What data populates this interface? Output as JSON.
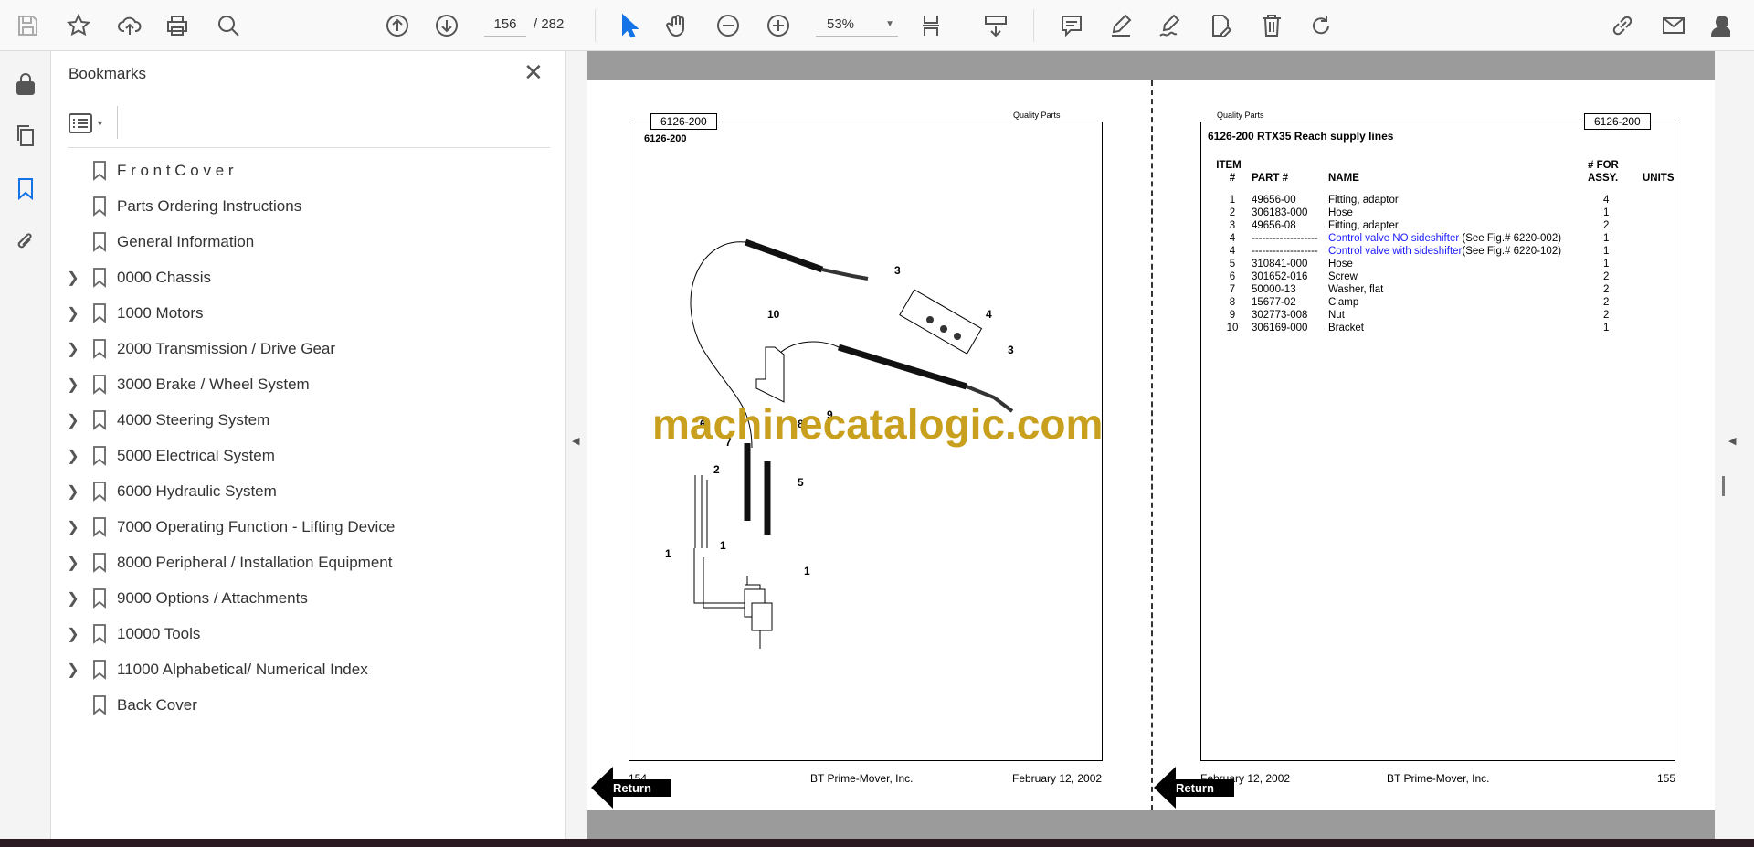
{
  "toolbar": {
    "current_page": "156",
    "total_pages": "/ 282",
    "zoom": "53%",
    "icons": [
      "save-icon",
      "star-icon",
      "upload-icon",
      "print-icon",
      "find-icon",
      "page-up-icon",
      "page-down-icon",
      "select-cursor-icon",
      "hand-icon",
      "zoom-out-icon",
      "zoom-in-icon",
      "page-fit-icon",
      "scroll-mode-icon",
      "comment-icon",
      "highlight-icon",
      "sign-icon",
      "edit-pdf-icon",
      "delete-icon",
      "rotate-icon",
      "share-link-icon",
      "email-icon",
      "account-icon"
    ],
    "accent": "#1473e6"
  },
  "panel": {
    "title": "Bookmarks",
    "bookmarks": [
      {
        "label": "F r o n t C o v e r",
        "expandable": false
      },
      {
        "label": "Parts Ordering Instructions",
        "expandable": false
      },
      {
        "label": "General Information",
        "expandable": false
      },
      {
        "label": "0000 Chassis",
        "expandable": true
      },
      {
        "label": "1000 Motors",
        "expandable": true
      },
      {
        "label": "2000 Transmission / Drive Gear",
        "expandable": true
      },
      {
        "label": "3000 Brake / Wheel System",
        "expandable": true
      },
      {
        "label": "4000 Steering System",
        "expandable": true
      },
      {
        "label": "5000 Electrical System",
        "expandable": true
      },
      {
        "label": "6000 Hydraulic System",
        "expandable": true
      },
      {
        "label": "7000 Operating Function - Lifting Device",
        "expandable": true
      },
      {
        "label": "8000 Peripheral / Installation Equipment",
        "expandable": true
      },
      {
        "label": "9000 Options / Attachments",
        "expandable": true
      },
      {
        "label": "10000 Tools",
        "expandable": true
      },
      {
        "label": "11000 Alphabetical/ Numerical Index",
        "expandable": true
      },
      {
        "label": "Back Cover",
        "expandable": false
      }
    ]
  },
  "left_page": {
    "tag": "6126-200",
    "quality": "Quality Parts",
    "heading": "6126-200",
    "callouts": [
      "1",
      "2",
      "3",
      "4",
      "5",
      "6",
      "7",
      "8",
      "9",
      "10"
    ],
    "page_number": "154",
    "company": "BT Prime-Mover, Inc.",
    "date": "February 12, 2002",
    "return_label": "Return"
  },
  "right_page": {
    "tag": "6126-200",
    "quality": "Quality Parts",
    "title": "6126-200 RTX35 Reach supply lines",
    "columns": {
      "item1": "ITEM",
      "item2": "#",
      "part": "PART #",
      "name": "NAME",
      "assy1": "# FOR",
      "assy2": "ASSY.",
      "units": "UNITS"
    },
    "rows": [
      {
        "item": "1",
        "part": "49656-00",
        "name": "Fitting, adaptor",
        "ref": "",
        "qty": "4",
        "link": false
      },
      {
        "item": "2",
        "part": "306183-000",
        "name": "Hose",
        "ref": "",
        "qty": "1",
        "link": false
      },
      {
        "item": "3",
        "part": "49656-08",
        "name": "Fitting, adapter",
        "ref": "",
        "qty": "2",
        "link": false
      },
      {
        "item": "4",
        "part": "-------------------",
        "name": "Control valve NO sideshifter",
        "ref": " (See Fig.# 6220-002)",
        "qty": "1",
        "link": true
      },
      {
        "item": "4",
        "part": "-------------------",
        "name": "Control valve with sideshifter",
        "ref": "(See Fig.# 6220-102)",
        "qty": "1",
        "link": true
      },
      {
        "item": "5",
        "part": "310841-000",
        "name": "Hose",
        "ref": "",
        "qty": "1",
        "link": false
      },
      {
        "item": "6",
        "part": "301652-016",
        "name": "Screw",
        "ref": "",
        "qty": "2",
        "link": false
      },
      {
        "item": "7",
        "part": "50000-13",
        "name": "Washer, flat",
        "ref": "",
        "qty": "2",
        "link": false
      },
      {
        "item": "8",
        "part": "15677-02",
        "name": "Clamp",
        "ref": "",
        "qty": "2",
        "link": false
      },
      {
        "item": "9",
        "part": "302773-008",
        "name": "Nut",
        "ref": "",
        "qty": "2",
        "link": false
      },
      {
        "item": "10",
        "part": "306169-000",
        "name": "Bracket",
        "ref": "",
        "qty": "1",
        "link": false
      }
    ],
    "page_number": "155",
    "company": "BT Prime-Mover, Inc.",
    "date": "February 12, 2002",
    "return_label": "Return"
  },
  "watermark": "machinecatalogic.com"
}
